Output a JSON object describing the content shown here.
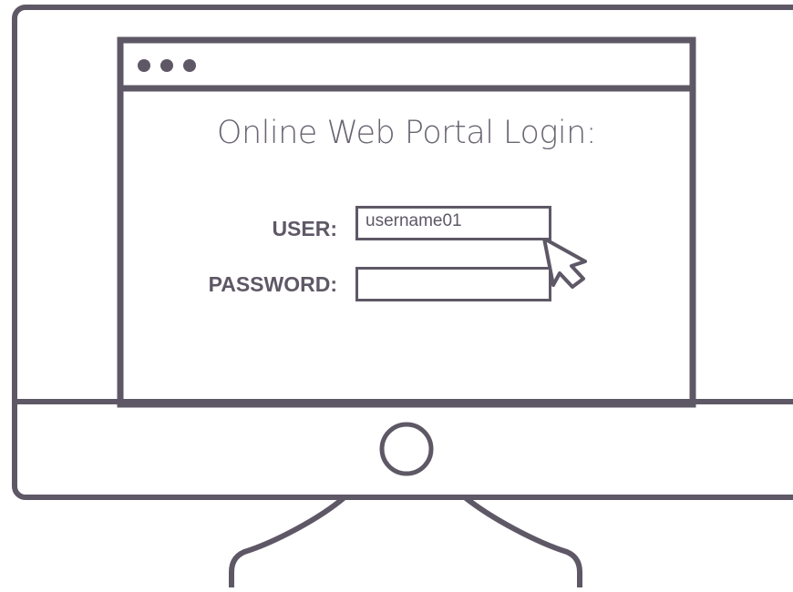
{
  "browser": {
    "controls": [
      "dot",
      "dot",
      "dot"
    ]
  },
  "login": {
    "title": "Online Web Portal Login:",
    "user_label": "USER:",
    "user_value": "username01",
    "password_label": "PASSWORD:",
    "password_value": ""
  },
  "icons": {
    "cursor": "pointer-cursor-icon",
    "power": "power-button-icon"
  },
  "colors": {
    "stroke": "#5e5866",
    "background": "#ffffff"
  }
}
